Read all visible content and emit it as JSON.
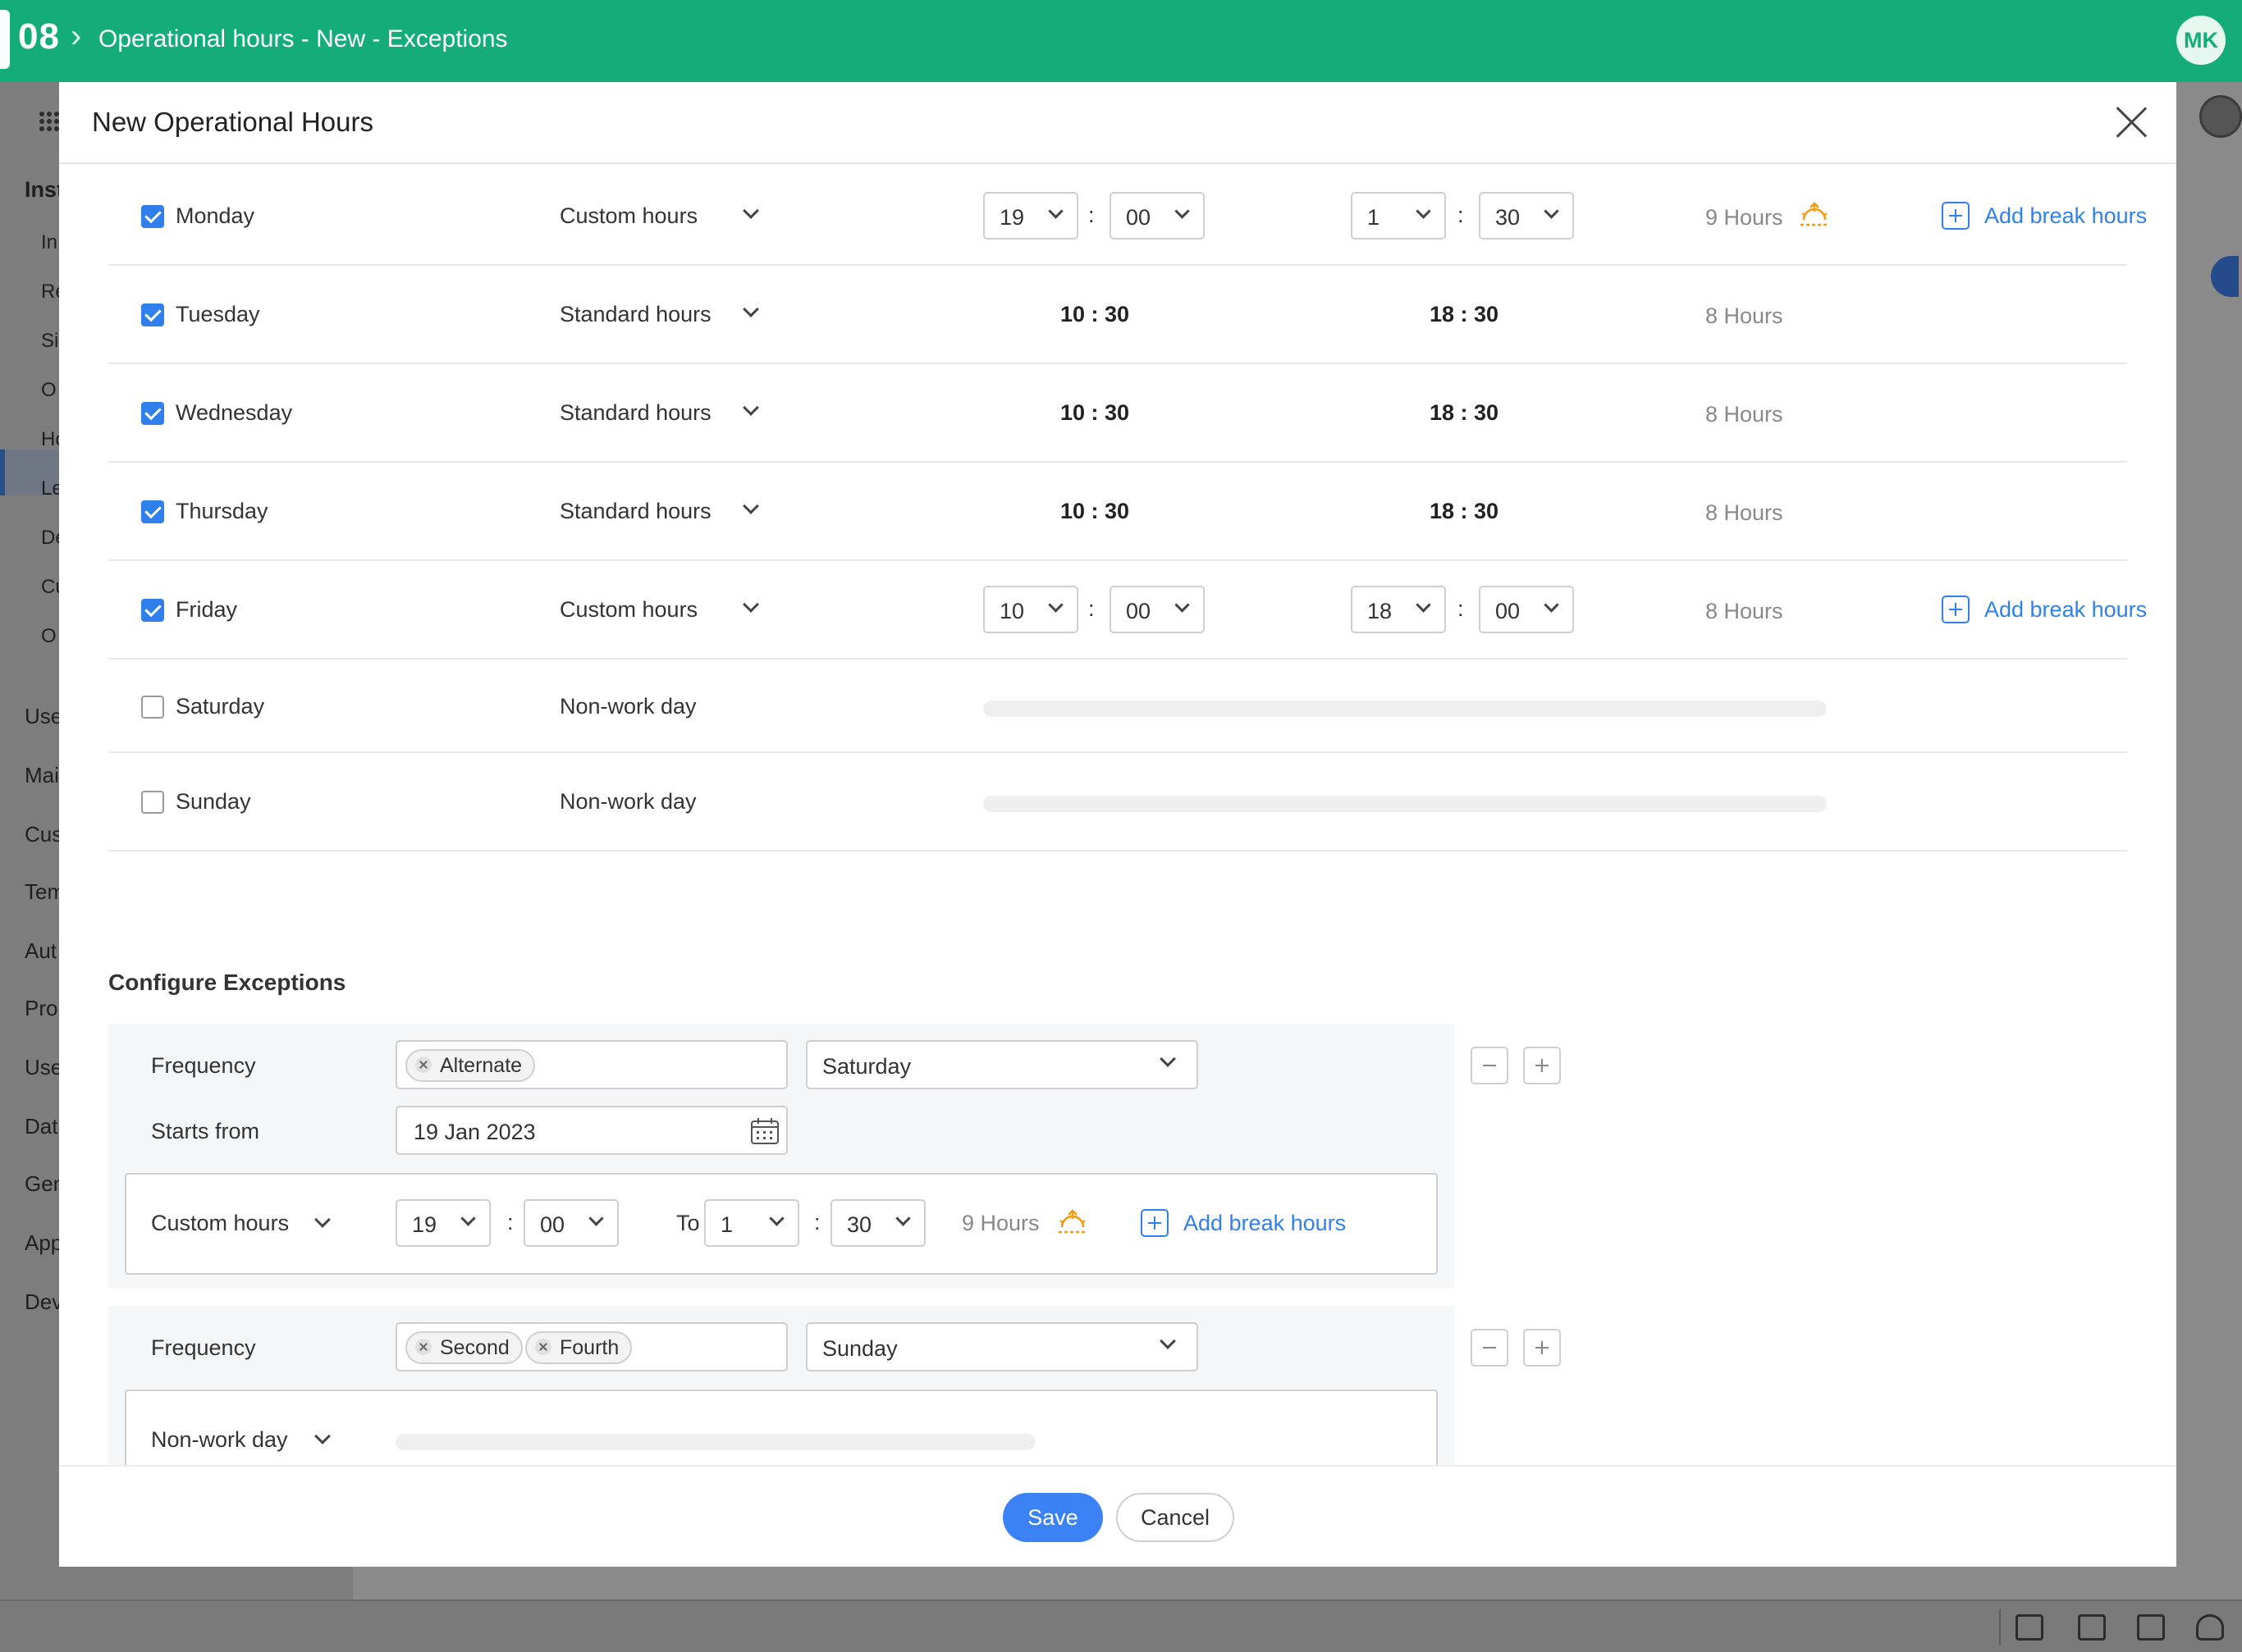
{
  "topbar": {
    "number": "08",
    "breadcrumb": "Operational hours - New - Exceptions",
    "avatar_initials": "MK",
    "color": "#14ad79"
  },
  "background_sidebar": {
    "items": [
      "Inst",
      "In",
      "Re",
      "Si",
      "O",
      "Ho",
      "Le",
      "De",
      "Cu",
      "O",
      "Use",
      "Mai",
      "Cus",
      "Tem",
      "Aut",
      "Prol",
      "Use",
      "Dat",
      "Gen",
      "App",
      "Dev"
    ]
  },
  "modal": {
    "title": "New Operational Hours",
    "days": [
      {
        "name": "Monday",
        "checked": true,
        "type": "Custom hours",
        "mode": "custom",
        "start_h": "19",
        "start_m": "00",
        "end_h": "1",
        "end_m": "30",
        "hours": "9 Hours",
        "overnight": true,
        "break_label": "Add break hours"
      },
      {
        "name": "Tuesday",
        "checked": true,
        "type": "Standard hours",
        "mode": "standard",
        "start": "10 : 30",
        "end": "18 : 30",
        "hours": "8 Hours"
      },
      {
        "name": "Wednesday",
        "checked": true,
        "type": "Standard hours",
        "mode": "standard",
        "start": "10 : 30",
        "end": "18 : 30",
        "hours": "8 Hours"
      },
      {
        "name": "Thursday",
        "checked": true,
        "type": "Standard hours",
        "mode": "standard",
        "start": "10 : 30",
        "end": "18 : 30",
        "hours": "8 Hours"
      },
      {
        "name": "Friday",
        "checked": true,
        "type": "Custom hours",
        "mode": "custom",
        "start_h": "10",
        "start_m": "00",
        "end_h": "18",
        "end_m": "00",
        "hours": "8 Hours",
        "overnight": false,
        "break_label": "Add break hours"
      },
      {
        "name": "Saturday",
        "checked": false,
        "type": "Non-work day",
        "mode": "off"
      },
      {
        "name": "Sunday",
        "checked": false,
        "type": "Non-work day",
        "mode": "off"
      }
    ],
    "exceptions": {
      "title": "Configure Exceptions",
      "frequency_label": "Frequency",
      "starts_label": "Starts from",
      "items": [
        {
          "tags": [
            "Alternate"
          ],
          "day": "Saturday",
          "start_date": "19 Jan 2023",
          "type": "Custom hours",
          "start_h": "19",
          "start_m": "00",
          "to_label": "To",
          "end_h": "1",
          "end_m": "30",
          "hours": "9 Hours",
          "break_label": "Add break hours"
        },
        {
          "tags": [
            "Second",
            "Fourth"
          ],
          "day": "Sunday",
          "type": "Non-work day"
        }
      ]
    },
    "save_label": "Save",
    "cancel_label": "Cancel"
  },
  "colors": {
    "accent_blue": "#2f80ed",
    "save_blue": "#3b82f6",
    "overnight_icon": "#f39c12"
  },
  "icons": [
    "grid-icon",
    "close-icon",
    "chevron-down-icon",
    "sun-moon-icon",
    "plus-icon",
    "calendar-icon",
    "minus-icon",
    "remove-tag-icon",
    "translate-icon",
    "notes-icon",
    "chat-icon",
    "bulb-icon"
  ]
}
